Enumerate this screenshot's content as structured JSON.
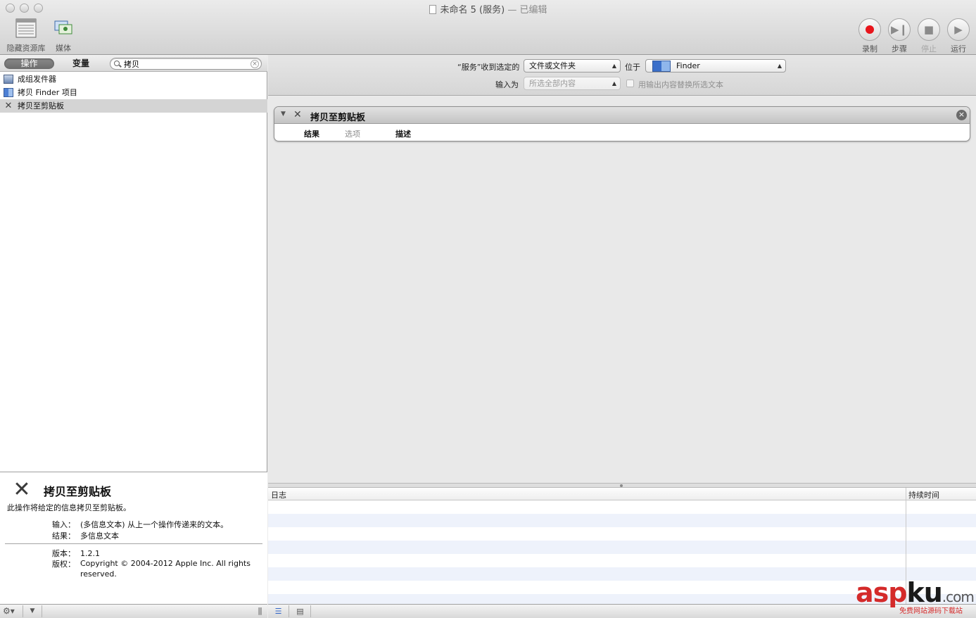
{
  "window": {
    "title": "未命名 5 (服务)",
    "title_suffix": "— 已编辑"
  },
  "toolbar": {
    "hide_library": "隐藏资源库",
    "media": "媒体",
    "record": "录制",
    "step": "步骤",
    "stop": "停止",
    "run": "运行"
  },
  "library": {
    "tab_actions": "操作",
    "tab_variables": "变量",
    "search_value": "拷贝",
    "items": [
      {
        "label": "成组发件器",
        "icon": "automator-icon"
      },
      {
        "label": "拷贝 Finder 项目",
        "icon": "finder-icon"
      },
      {
        "label": "拷贝至剪贴板",
        "icon": "tools-icon",
        "selected": true
      }
    ]
  },
  "description": {
    "title": "拷贝至剪贴板",
    "text": "此操作将给定的信息拷贝至剪贴板。",
    "input_label": "输入：",
    "input_value": "(多信息文本) 从上一个操作传递来的文本。",
    "result_label": "结果：",
    "result_value": "多信息文本",
    "version_label": "版本：",
    "version_value": "1.2.1",
    "copyright_label": "版权：",
    "copyright_value": "Copyright © 2004-2012 Apple Inc.  All rights reserved."
  },
  "workflow": {
    "receives_label": "“服务”收到选定的",
    "receives_value": "文件或文件夹",
    "in_label": "位于",
    "in_value": "Finder",
    "input_is_label": "输入为",
    "input_is_value": "所选全部内容",
    "replace_label": "用输出内容替换所选文本",
    "replace_checked": false
  },
  "action": {
    "title": "拷贝至剪贴板",
    "tabs": [
      "结果",
      "选项",
      "描述"
    ]
  },
  "log": {
    "col_log": "日志",
    "col_duration": "持续时间"
  },
  "watermark": {
    "brand_asp": "asp",
    "brand_ku": "ku",
    "brand_com": ".com",
    "subtitle": "免费网站源码下载站"
  }
}
